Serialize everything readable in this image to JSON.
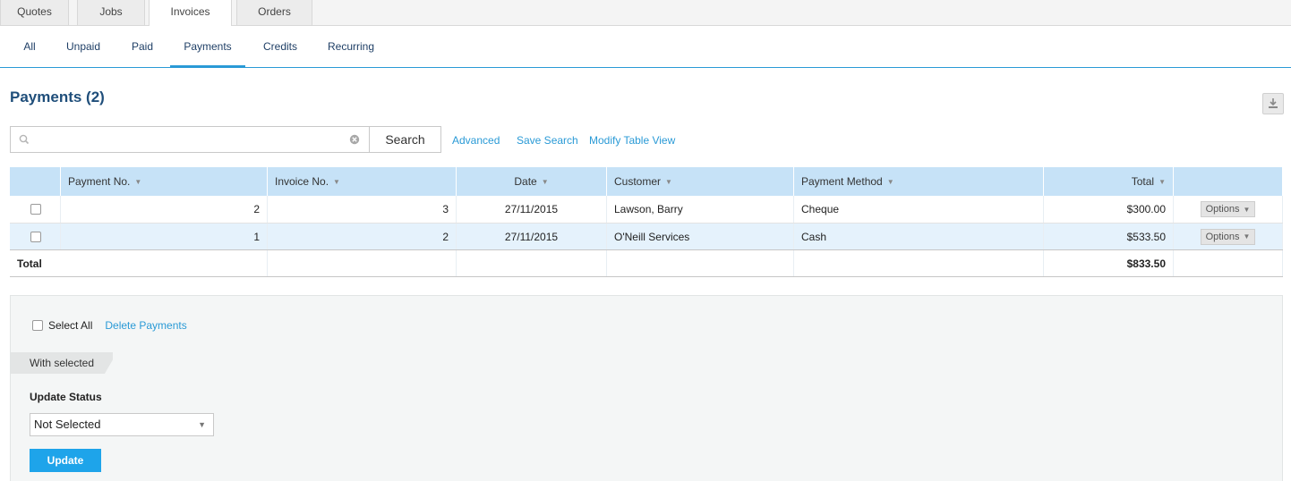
{
  "top_tabs": [
    {
      "label": "Quotes",
      "active": false
    },
    {
      "label": "Jobs",
      "active": false
    },
    {
      "label": "Invoices",
      "active": true
    },
    {
      "label": "Orders",
      "active": false
    }
  ],
  "sub_tabs": [
    {
      "label": "All",
      "active": false
    },
    {
      "label": "Unpaid",
      "active": false
    },
    {
      "label": "Paid",
      "active": false
    },
    {
      "label": "Payments",
      "active": true
    },
    {
      "label": "Credits",
      "active": false
    },
    {
      "label": "Recurring",
      "active": false
    }
  ],
  "page": {
    "title": "Payments (2)"
  },
  "search": {
    "value": "",
    "placeholder": "",
    "button_label": "Search",
    "advanced_label": "Advanced",
    "save_label": "Save Search",
    "modify_label": "Modify Table View"
  },
  "table": {
    "columns": [
      "Payment No.",
      "Invoice No.",
      "Date",
      "Customer",
      "Payment Method",
      "Total"
    ],
    "rows": [
      {
        "payment_no": "2",
        "invoice_no": "3",
        "date": "27/11/2015",
        "customer": "Lawson, Barry",
        "method": "Cheque",
        "total": "$300.00",
        "options": "Options"
      },
      {
        "payment_no": "1",
        "invoice_no": "2",
        "date": "27/11/2015",
        "customer": "O'Neill Services",
        "method": "Cash",
        "total": "$533.50",
        "options": "Options"
      }
    ],
    "footer": {
      "label": "Total",
      "total": "$833.50"
    }
  },
  "bulk": {
    "select_all_label": "Select All",
    "delete_label": "Delete Payments",
    "with_selected_label": "With selected",
    "update_status_label": "Update Status",
    "status_value": "Not Selected",
    "update_button_label": "Update"
  },
  "colors": {
    "accent": "#2a9ad6",
    "header_bg": "#c6e2f7",
    "alt_row": "#e5f2fc",
    "update_btn": "#1ea4ea",
    "title": "#1f4e7a"
  }
}
